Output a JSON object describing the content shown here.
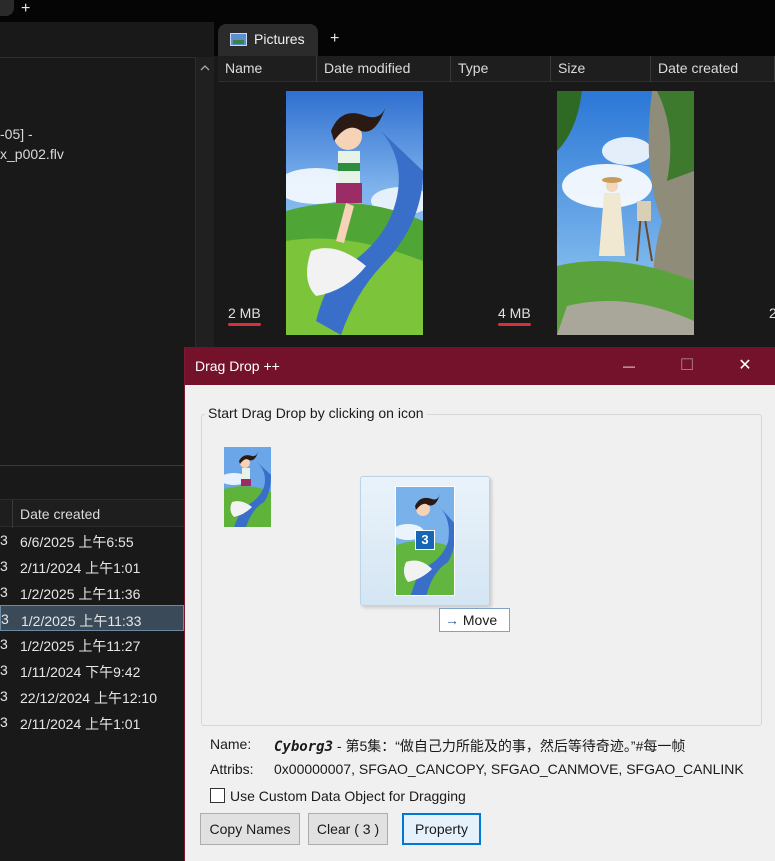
{
  "explorer": {
    "new_tab_label": "+",
    "left_files": [
      "-05] -",
      "x_p002.flv"
    ],
    "pictures_tab": {
      "label": "Pictures",
      "new_tab_label": "+"
    },
    "columns": [
      "Name",
      "Date modified",
      "Type",
      "Size",
      "Date created"
    ],
    "thumbnails": [
      {
        "size": "2 MB"
      },
      {
        "size": "4 MB"
      }
    ],
    "third_size_partial": "2",
    "bottom_list": {
      "header": "Date created",
      "rows": [
        {
          "c1": "3",
          "date": "6/6/2025 上午6:55",
          "selected": false
        },
        {
          "c1": "3",
          "date": "2/11/2024 上午1:01",
          "selected": false
        },
        {
          "c1": "3",
          "date": "1/2/2025 上午11:36",
          "selected": false
        },
        {
          "c1": "3",
          "date": "1/2/2025 上午11:33",
          "selected": true
        },
        {
          "c1": "3",
          "date": "1/2/2025 上午11:27",
          "selected": false
        },
        {
          "c1": "3",
          "date": "1/11/2024 下午9:42",
          "selected": false
        },
        {
          "c1": "3",
          "date": "22/12/2024 上午12:10",
          "selected": false
        },
        {
          "c1": "3",
          "date": "2/11/2024 上午1:01",
          "selected": false
        }
      ]
    }
  },
  "dialog": {
    "title": "Drag Drop ++",
    "controls": {
      "minimize": "—",
      "maximize": "☐",
      "close": "✕"
    },
    "group_label": "Start Drag Drop by clicking on icon",
    "drag_count": "3",
    "move_label": "Move",
    "name_label": "Name:",
    "name_bold": "Cyborg3",
    "name_rest": " - 第5集：“做自己力所能及的事，然后等待奇迹。”#每一帧",
    "attribs_label": "Attribs:",
    "attribs_value": "0x00000007, SFGAO_CANCOPY, SFGAO_CANMOVE, SFGAO_CANLINK",
    "checkbox_label": "Use Custom Data Object for Dragging",
    "checkbox_checked": false,
    "buttons": {
      "copy_names": "Copy Names",
      "clear": "Clear ( 3 )",
      "property": "Property"
    }
  },
  "colors": {
    "title_bar": "#74112b",
    "selection": "#3b4a58",
    "accent_underline": "#d7303a",
    "focus_border": "#0078d7"
  }
}
